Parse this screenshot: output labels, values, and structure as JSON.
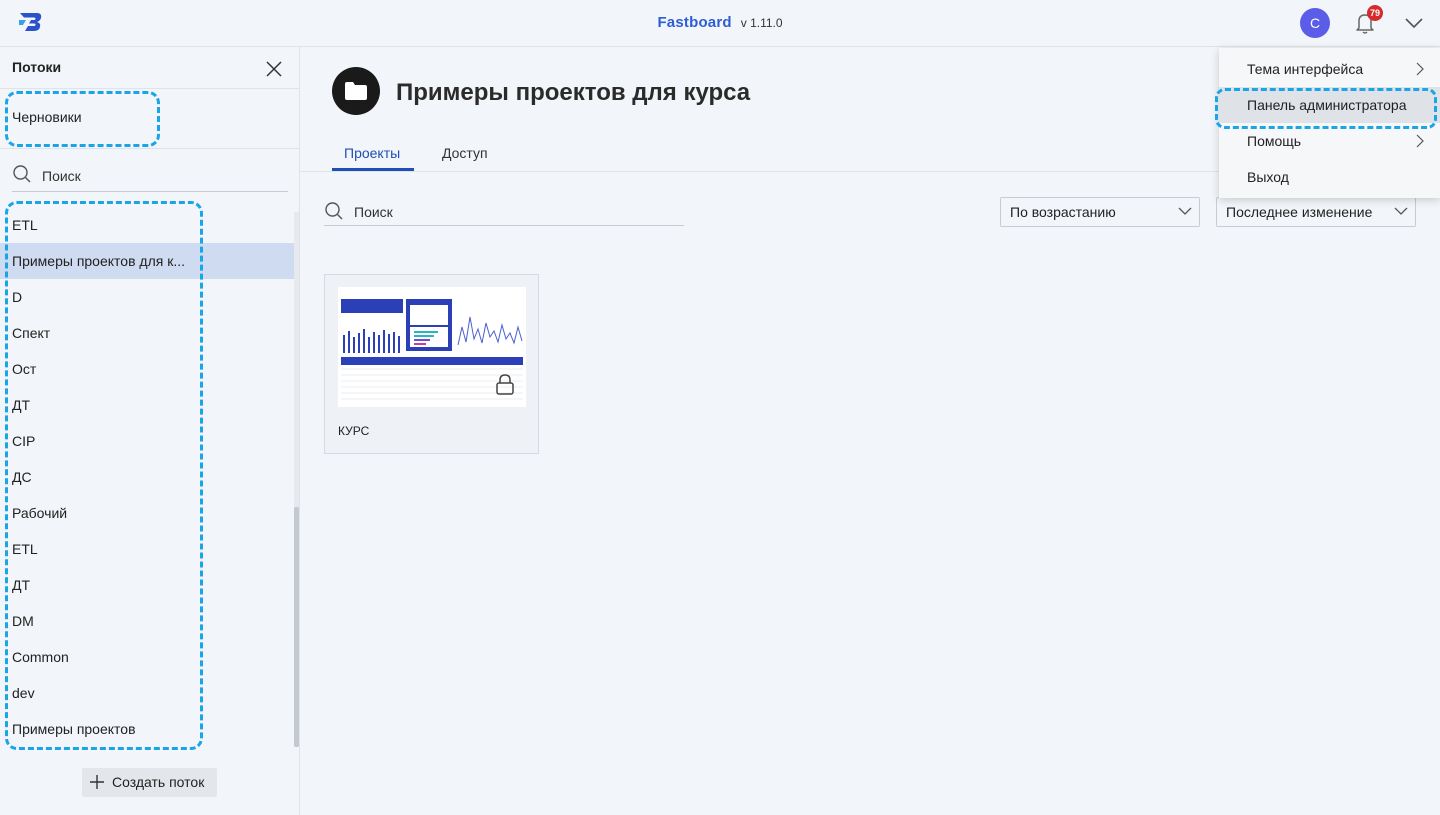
{
  "header": {
    "brand": "Fastboard",
    "version": "v 1.11.0",
    "avatar_initial": "C",
    "notification_count": "79"
  },
  "sidebar": {
    "title": "Потоки",
    "drafts": "Черновики",
    "search_placeholder": "Поиск",
    "flows": [
      {
        "label": "ETL"
      },
      {
        "label": "Примеры проектов для к..."
      },
      {
        "label": "D"
      },
      {
        "label": "Спект"
      },
      {
        "label": "Ост"
      },
      {
        "label": "ДТ"
      },
      {
        "label": "CIP"
      },
      {
        "label": "ДС"
      },
      {
        "label": "Рабочий"
      },
      {
        "label": "ETL"
      },
      {
        "label": "ДТ"
      },
      {
        "label": "DM"
      },
      {
        "label": "Common"
      },
      {
        "label": "dev"
      },
      {
        "label": "Примеры проектов"
      }
    ],
    "active_flow_index": 1,
    "create_button": "Создать поток"
  },
  "main": {
    "title": "Примеры проектов для курса",
    "tabs": [
      {
        "label": "Проекты"
      },
      {
        "label": "Доступ"
      }
    ],
    "search_placeholder": "Поиск",
    "sort_order": "По возрастанию",
    "sort_by": "Последнее изменение",
    "projects": [
      {
        "name": "КУРС",
        "locked": true
      }
    ]
  },
  "user_menu": {
    "items": [
      {
        "label": "Тема интерфейса",
        "submenu": true
      },
      {
        "label": "Панель администратора",
        "submenu": false
      },
      {
        "label": "Помощь",
        "submenu": true
      },
      {
        "label": "Выход",
        "submenu": false
      }
    ]
  },
  "colors": {
    "accent": "#1f4fb4",
    "brand": "#2f5dd4",
    "highlight": "#1aa5e6",
    "active_row": "#cfdbf0",
    "badge": "#d62b2b",
    "avatar": "#5b5ce8"
  }
}
